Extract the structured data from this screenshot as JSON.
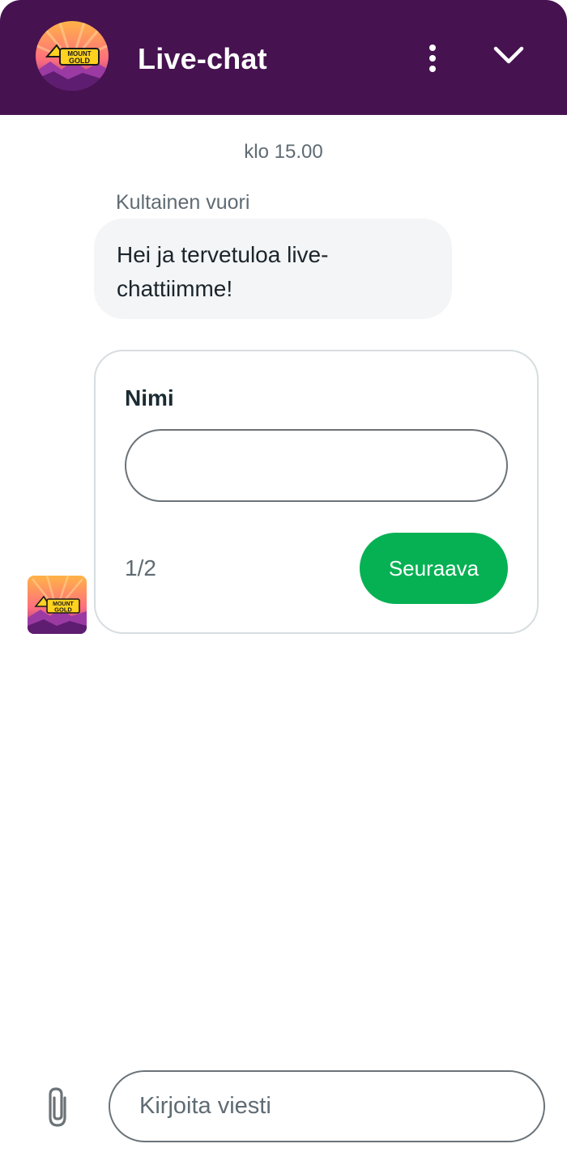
{
  "header": {
    "title": "Live-chat",
    "logo_text_top": "MOUNT",
    "logo_text_bottom": "GOLD",
    "icons": [
      "more-vertical-icon",
      "chevron-down-icon"
    ]
  },
  "conversation": {
    "timestamp": "klo 15.00",
    "sender": "Kultainen vuori",
    "message": "Hei ja tervetuloa live-chattiimme!"
  },
  "form": {
    "field_label": "Nimi",
    "field_value": "",
    "step": "1/2",
    "next_label": "Seuraava"
  },
  "composer": {
    "placeholder": "Kirjoita viesti",
    "attach_icon": "paperclip-icon"
  },
  "colors": {
    "header_bg": "#461250",
    "accent_green": "#06b153",
    "bubble_bg": "#f3f5f7"
  }
}
